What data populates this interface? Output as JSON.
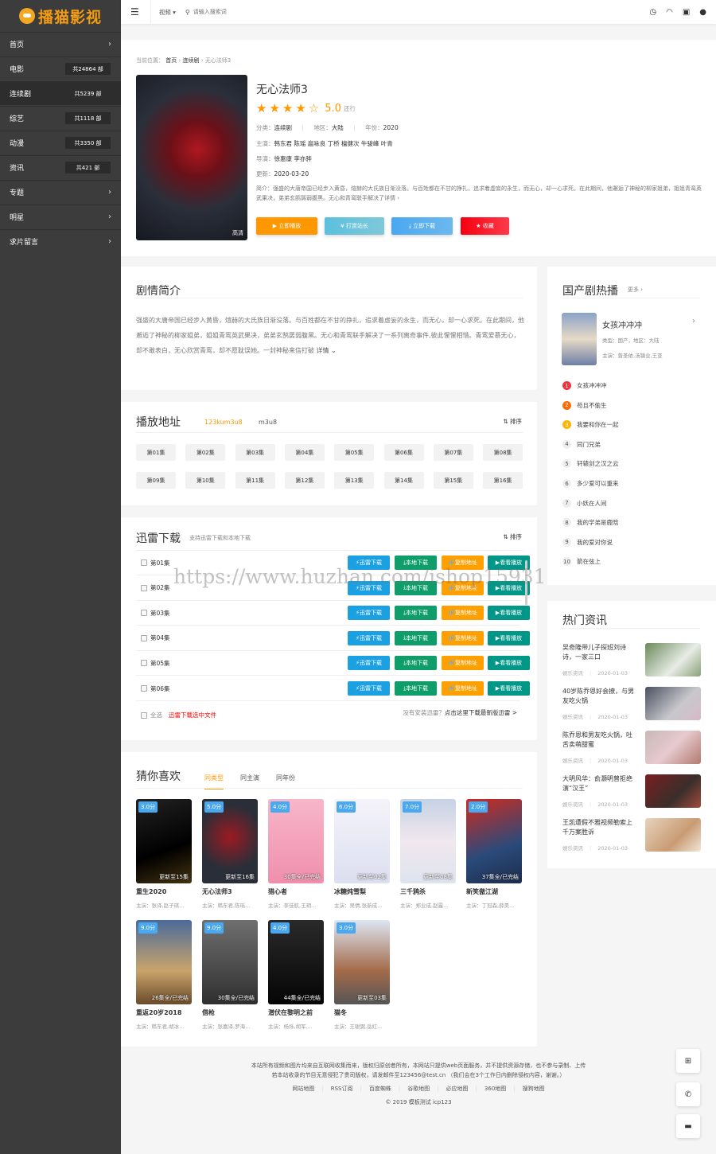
{
  "logo": {
    "text": "播猫影视"
  },
  "sidebar": {
    "items": [
      {
        "label": "首页",
        "count": null
      },
      {
        "label": "电影",
        "count": "共24864 部"
      },
      {
        "label": "连续剧",
        "count": "共5239 部",
        "active": true
      },
      {
        "label": "综艺",
        "count": "共1118 部"
      },
      {
        "label": "动漫",
        "count": "共3350 部"
      },
      {
        "label": "资讯",
        "count": "共421 部"
      },
      {
        "label": "专题",
        "count": null
      },
      {
        "label": "明星",
        "count": null
      },
      {
        "label": "求片留言",
        "count": null
      }
    ]
  },
  "topbar": {
    "menu_icon": "list-icon",
    "category": "视频",
    "search_placeholder": "请输入搜索词",
    "icons": [
      "clock-icon",
      "rss-icon",
      "android-icon",
      "user-icon"
    ]
  },
  "breadcrumb": {
    "prefix": "当前位置：",
    "items": [
      "首页",
      "连续剧",
      "无心法师3"
    ]
  },
  "detail": {
    "title": "无心法师3",
    "rating": 5.0,
    "rating_text": "5.0",
    "rating_stars": 4,
    "status": "还行",
    "poster_badge": "高清",
    "category_label": "分类：",
    "category": "连续剧",
    "region_label": "地区：",
    "region": "大陆",
    "year_label": "年份：",
    "year": "2020",
    "cast_label": "主演：",
    "cast": "韩东君 陈瑶 扈咏良 丁桥 檀健次 牛骏峰 叶青",
    "director_label": "导演：",
    "director": "徐惠康 李亦骅",
    "updated_label": "更新：",
    "updated": "2020-03-20",
    "summary_label": "简介：",
    "summary": "强盛的大唐帝国已经步入黄昏，煊赫的大氏族日渐没落。与百姓都在不甘的挣扎，追求着虚妄的永生，而无心，却一心求死。在此期间，他邂逅了神秘的柳家姐弟，姐姐青鸾英武果决，弟弟玄鹄孱弱腹黑。无心和青鸾联手解决了详情 ›",
    "buttons": {
      "play": "▶ 立即播放",
      "tip": "¥ 打赏站长",
      "download": "立即下载",
      "fav": "★ 收藏"
    }
  },
  "intro": {
    "title": "剧情简介",
    "text": "强盛的大唐帝国已经步入黄昏，煊赫的大氏族日渐没落。与百姓都在不甘的挣扎，追求着虚妄的永生，而无心，却一心求死。在此期间，他邂逅了神秘的柳家姐弟，姐姐青鸾英武果决，弟弟玄鹄孱弱腹黑。无心和青鸾联手解决了一系列离奇事件,彼此惺惺相惜。青鸾爱慕无心，却不敢表白，无心欣赏青鸾，却不愿耽误她。一封神秘来信打破",
    "more": "详情 ⌄"
  },
  "play": {
    "title": "播放地址",
    "tabs": [
      "123kum3u8",
      "m3u8"
    ],
    "active_tab": 0,
    "sort": "排序",
    "episodes": [
      "第01集",
      "第02集",
      "第03集",
      "第04集",
      "第05集",
      "第06集",
      "第07集",
      "第08集",
      "第09集",
      "第10集",
      "第11集",
      "第12集",
      "第13集",
      "第14集",
      "第15集",
      "第16集"
    ]
  },
  "download": {
    "title": "迅雷下载",
    "subtitle": "支持迅雷下载和本地下载",
    "sort": "排序",
    "rows": [
      "第01集",
      "第02集",
      "第03集",
      "第04集",
      "第05集",
      "第06集"
    ],
    "buttons": {
      "thunder": "迅雷下载",
      "local": "本地下载",
      "copy": "复制地址",
      "play": "看看播放"
    },
    "select_all": "全选",
    "download_selected": "迅雷下载选中文件",
    "hint": "没有安装迅雷？",
    "hint_link": "点击这里下载最新版迅雷 >"
  },
  "watermark": "https://www.huzhan.com/ishop15931",
  "guess": {
    "title": "猜你喜欢",
    "tabs": [
      "同类型",
      "同主演",
      "同年份"
    ],
    "active_tab": 0,
    "items": [
      {
        "title": "重生2020",
        "score": "3.0分",
        "note": "更新至15集",
        "cast": "主演：张译,赵子琪..."
      },
      {
        "title": "无心法师3",
        "score": "5.0分",
        "note": "更新至16集",
        "cast": "主演：韩东君,陈瑶..."
      },
      {
        "title": "猎心者",
        "score": "4.0分",
        "note": "30集全/已完结",
        "cast": "主演：李佳航,王玥..."
      },
      {
        "title": "冰糖炖雪梨",
        "score": "6.0分",
        "note": "更新至02集",
        "cast": "主演：吴倩,张新成..."
      },
      {
        "title": "三千鸦杀",
        "score": "7.0分",
        "note": "更新至08集",
        "cast": "主演：郑业成,赵露..."
      },
      {
        "title": "新笑傲江湖",
        "score": "2.0分",
        "note": "37集全/已完结",
        "cast": "主演：丁冠森,薛昊..."
      },
      {
        "title": "重返20岁2018",
        "score": "9.0分",
        "note": "26集全/已完结",
        "cast": "主演：韩东君,胡冰..."
      },
      {
        "title": "借枪",
        "score": "9.0分",
        "note": "30集全/已完结",
        "cast": "主演：张嘉译,罗海..."
      },
      {
        "title": "潜伏在黎明之前",
        "score": "4.0分",
        "note": "44集全/已完结",
        "cast": "主演：杨烁,胡军,..."
      },
      {
        "title": "猫冬",
        "score": "3.0分",
        "note": "更新至03集",
        "cast": "主演：王聪弼,岳红..."
      }
    ]
  },
  "hot": {
    "title": "国产剧热播",
    "more": "更多 ›",
    "featured": {
      "title": "女孩冲冲冲",
      "type": "类型：国产，地区：大陆",
      "cast": "主演：曾圣依,汤镇业,王亚"
    },
    "ranks": [
      "女孩冲冲冲",
      "苟且不偷生",
      "我要和你在一起",
      "同门兄弟",
      "轩辕剑之汉之云",
      "多少爱可以重来",
      "小妖在人间",
      "我的学弟是鹿晗",
      "我的爱对你说",
      "箭在弦上"
    ]
  },
  "news": {
    "title": "热门资讯",
    "items": [
      {
        "title": "吴奇隆带儿子探班刘诗诗，一家三口",
        "category": "娱乐资讯",
        "date": "2020-01-03"
      },
      {
        "title": "40岁陈乔恩好会撩，与男友吃火锅",
        "category": "娱乐资讯",
        "date": "2020-01-03"
      },
      {
        "title": "陈乔恩和男友吃火锅，吐舌卖萌甜蜜",
        "category": "娱乐资讯",
        "date": "2020-01-03"
      },
      {
        "title": "大明风华：俞灏明曾拒绝演“汉王”",
        "category": "娱乐资讯",
        "date": "2020-01-03"
      },
      {
        "title": "王凯遭假不雅视频勒索上千万案胜诉",
        "category": "娱乐资讯",
        "date": "2020-01-03"
      }
    ]
  },
  "footer": {
    "line1": "本站所有视频和图片均来自互联网收集而来，版权归原创者所有，本网站只提供web页面服务，并不提供资源存储，也不参与录制、上传",
    "line2": "若本站收录的节目无意侵犯了贵司版权，请发邮件至123456@test.cn （我们会在3个工作日内删除侵权内容，谢谢。）",
    "links": [
      "网站地图",
      "RSS订阅",
      "百度蜘蛛",
      "谷歌地图",
      "必应地图",
      "360地图",
      "搜狗地图"
    ],
    "copyright": "© 2019 模板测试 icp123"
  },
  "float_icons": [
    "windows-icon",
    "wechat-icon",
    "chat-icon"
  ],
  "colors": {
    "accent": "#ff9800",
    "sidebar": "#3c3c3c",
    "play": "#ff9800",
    "tip": "#5bc0de",
    "download": "#4aa8f0",
    "fav": "#f5000f",
    "thunder": "#1ba1e2",
    "local": "#0f9d6b",
    "copy": "#ff9f00",
    "watch": "#009688"
  }
}
